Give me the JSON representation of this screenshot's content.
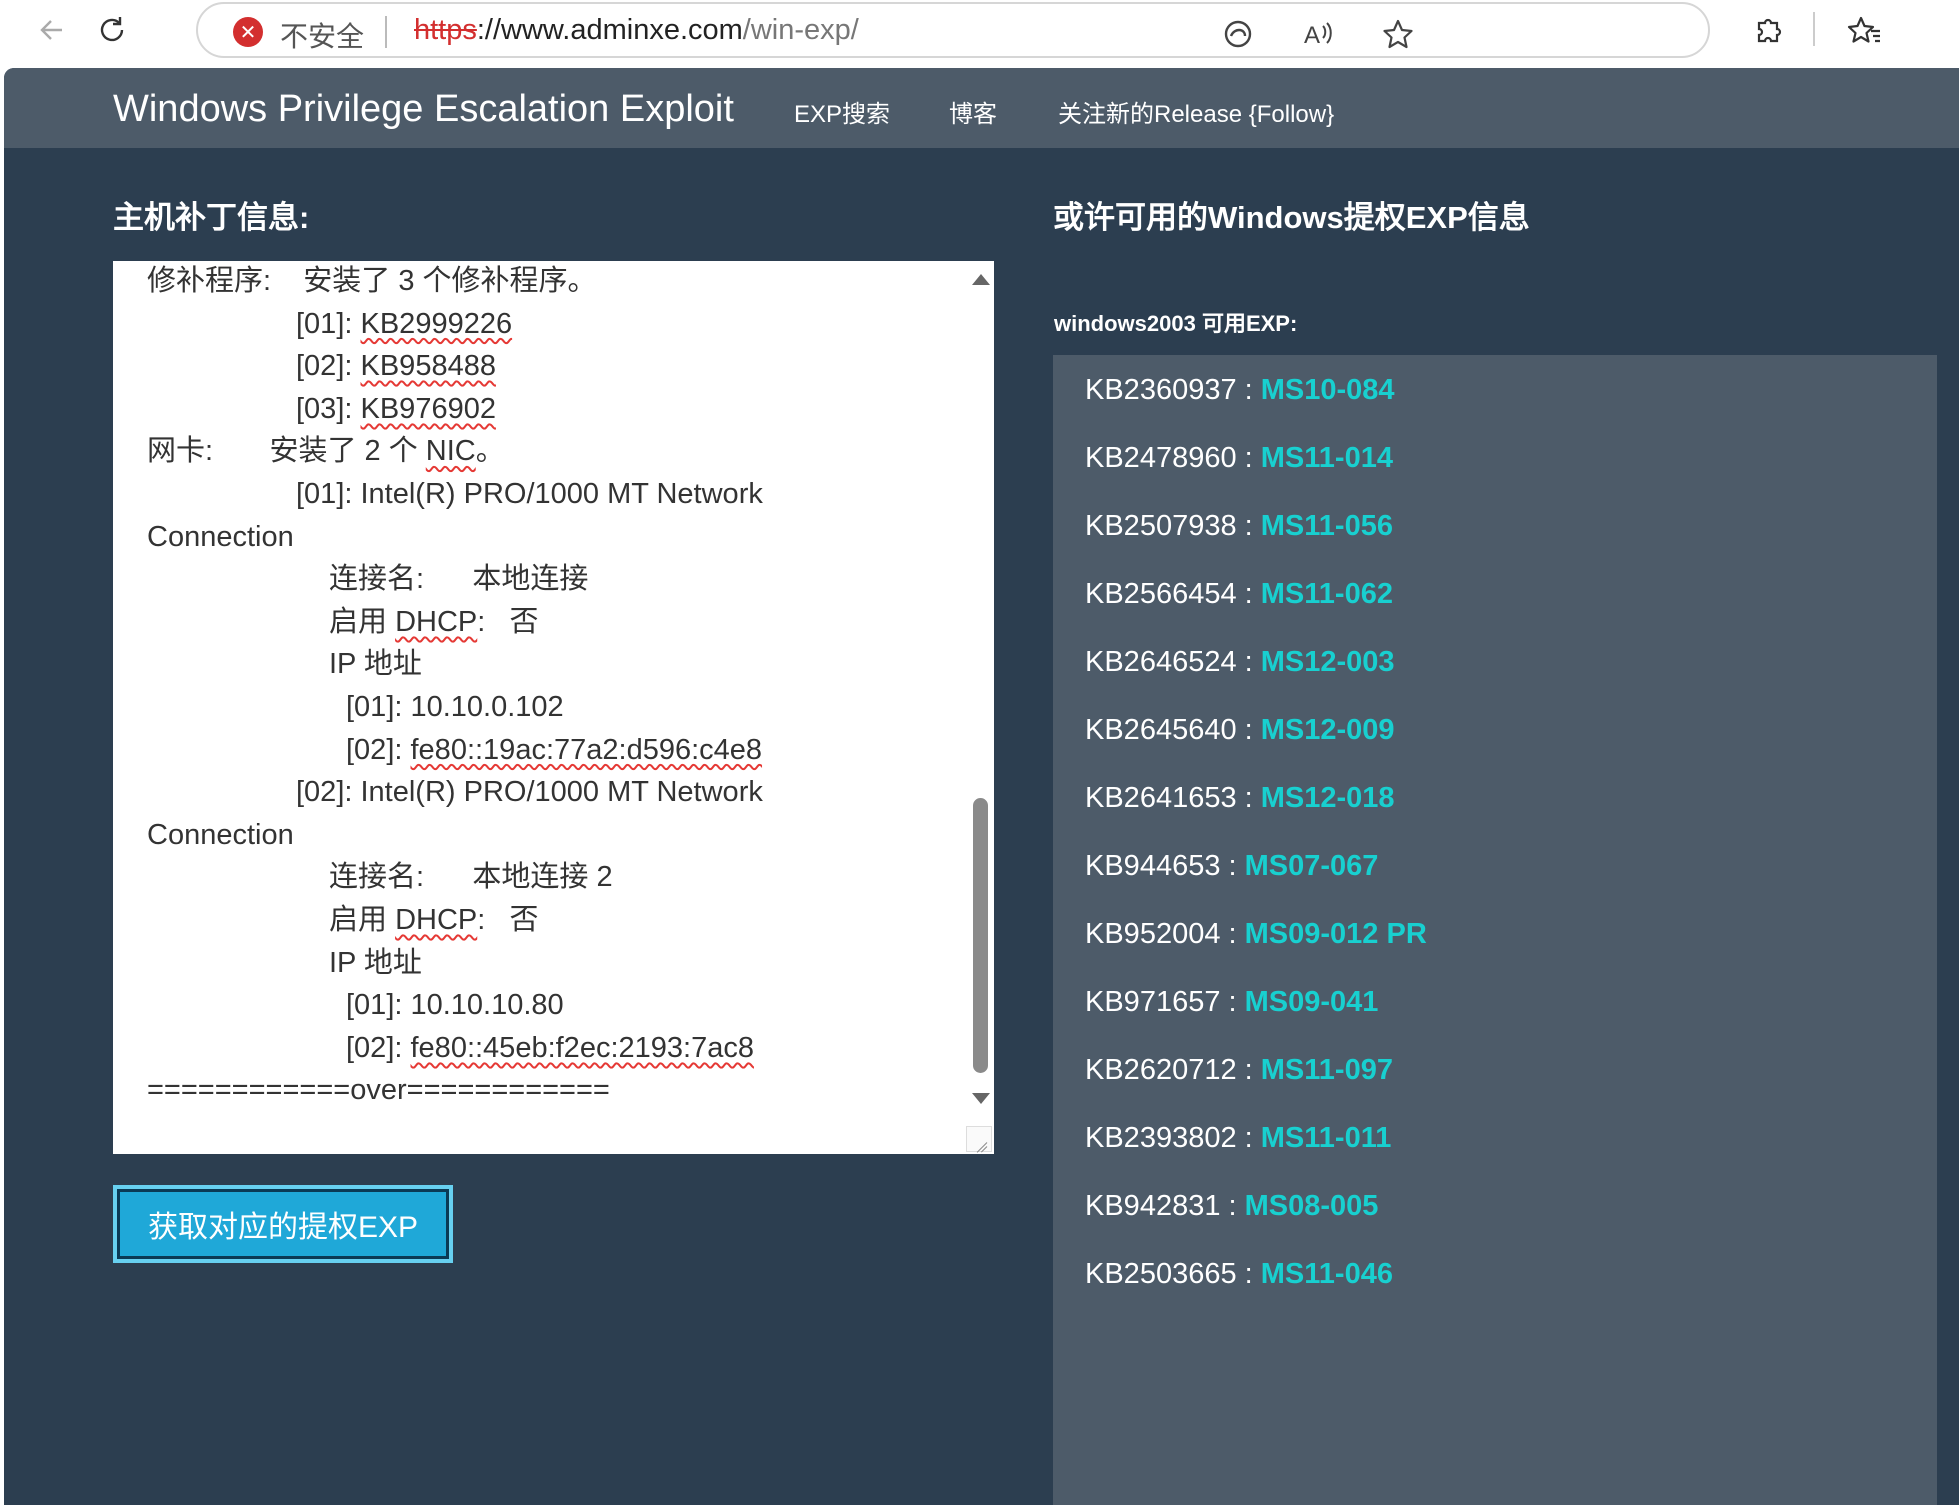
{
  "browser": {
    "insecure_label": "不安全",
    "url_proto": "https",
    "url_host": "://www.adminxe.com",
    "url_path": "/win-exp/"
  },
  "navbar": {
    "brand": "Windows Privilege Escalation Exploit",
    "links": [
      "EXP搜索",
      "博客",
      "关注新的Release {Follow}"
    ]
  },
  "left": {
    "title": "主机补丁信息:",
    "textarea_lines": [
      [
        "修补程序:",
        "    安装了 3 个修补程序。"
      ],
      [
        "",
        "[01]: ",
        "KB2999226"
      ],
      [
        "",
        "[02]: ",
        "KB958488"
      ],
      [
        "",
        "[03]: ",
        "KB976902"
      ],
      [
        "网卡:",
        "       安装了 2 个 ",
        "NIC",
        "。"
      ],
      [
        "",
        "[01]: Intel(R) PRO/1000 MT Network"
      ],
      [
        "Connection"
      ],
      [
        "",
        "连接名:      本地连接"
      ],
      [
        "",
        "启用 ",
        "DHCP",
        ":   否"
      ],
      [
        "",
        "IP 地址"
      ],
      [
        "",
        "[01]: 10.10.0.102"
      ],
      [
        "",
        "[02]: ",
        "fe80::19ac:77a2:d596:c4e8"
      ],
      [
        "",
        "[02]: Intel(R) PRO/1000 MT Network"
      ],
      [
        "Connection"
      ],
      [
        "",
        "连接名:      本地连接 2"
      ],
      [
        "",
        "启用 ",
        "DHCP",
        ":   否"
      ],
      [
        "",
        "IP 地址"
      ],
      [
        "",
        "[01]: 10.10.10.80"
      ],
      [
        "",
        "[02]: ",
        "fe80::45eb:f2ec:2193:7ac8"
      ],
      [
        "============over============"
      ]
    ],
    "button_label": "获取对应的提权EXP"
  },
  "right": {
    "title": "或许可用的Windows提权EXP信息",
    "os_label": "windows2003 可用EXP:",
    "exps": [
      {
        "kb": "KB2360937",
        "ms": "MS10-084"
      },
      {
        "kb": "KB2478960",
        "ms": "MS11-014"
      },
      {
        "kb": "KB2507938",
        "ms": "MS11-056"
      },
      {
        "kb": "KB2566454",
        "ms": "MS11-062"
      },
      {
        "kb": "KB2646524",
        "ms": "MS12-003"
      },
      {
        "kb": "KB2645640",
        "ms": "MS12-009"
      },
      {
        "kb": "KB2641653",
        "ms": "MS12-018"
      },
      {
        "kb": "KB944653",
        "ms": "MS07-067"
      },
      {
        "kb": "KB952004",
        "ms": "MS09-012 PR"
      },
      {
        "kb": "KB971657",
        "ms": "MS09-041"
      },
      {
        "kb": "KB2620712",
        "ms": "MS11-097"
      },
      {
        "kb": "KB2393802",
        "ms": "MS11-011"
      },
      {
        "kb": "KB942831",
        "ms": "MS08-005"
      },
      {
        "kb": "KB2503665",
        "ms": "MS11-046"
      }
    ],
    "separator": " : "
  },
  "colors": {
    "page_bg": "#2c3e50",
    "navbar_bg": "#4d5b69",
    "panel_bg": "#4d5b69",
    "accent_ms": "#18d0d0",
    "button_bg": "#1fa8d8"
  }
}
